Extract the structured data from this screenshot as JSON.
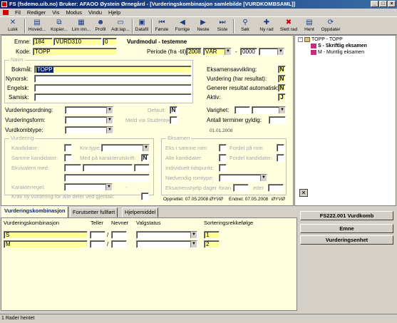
{
  "window": {
    "title": "FS (fsdemo.uib.no) Bruker: AFAOO Øystein Ørnegård - [Vurderingskombinasjon samlebilde   [VURDKOMBSAML]]"
  },
  "menu": [
    "Fil",
    "Rediger",
    "Vis",
    "Modus",
    "Vindu",
    "Hjelp"
  ],
  "toolbar": [
    {
      "label": "Lukk",
      "icon": "close-icon"
    },
    {
      "label": "Hoved...",
      "icon": "home-icon"
    },
    {
      "label": "Kopier...",
      "icon": "copy-icon"
    },
    {
      "label": "Lim inn...",
      "icon": "paste-icon"
    },
    {
      "label": "Profil",
      "icon": "profile-icon"
    },
    {
      "label": "Adr.lap...",
      "icon": "address-label-icon"
    },
    {
      "label": "Datafil",
      "icon": "datafile-icon"
    },
    {
      "label": "Første",
      "icon": "first-icon"
    },
    {
      "label": "Forrige",
      "icon": "previous-icon"
    },
    {
      "label": "Neste",
      "icon": "next-icon"
    },
    {
      "label": "Siste",
      "icon": "last-icon"
    },
    {
      "label": "Søk",
      "icon": "search-icon"
    },
    {
      "label": "Ny rad",
      "icon": "new-row-icon"
    },
    {
      "label": "Slett rad",
      "icon": "delete-row-icon"
    },
    {
      "label": "Hent",
      "icon": "fetch-icon"
    },
    {
      "label": "Oppdater",
      "icon": "update-icon"
    }
  ],
  "header": {
    "emne_label": "Emne:",
    "emne_code": "184",
    "emne_id": "VURD310",
    "emne_version": "0",
    "module_title": "Vurdmodul - testemne",
    "kode_label": "Kode:",
    "kode_value": "TOPP",
    "periode_label": "Periode (fra -til):",
    "periode_year": "2008",
    "periode_term": "VÅR",
    "periode_dash": "-",
    "periode_to": "0000"
  },
  "navn": {
    "group_label": "Navn",
    "bokmal_label": "Bokmål:",
    "bokmal_value": "TOPP",
    "nynorsk_label": "Nynorsk:",
    "engelsk_label": "Engelsk:",
    "samisk_label": "Samisk:"
  },
  "flags": {
    "eksamensavvikling_label": "Eksamensavvikling:",
    "eksamensavvikling": "N",
    "vurdering_har_resultat_label": "Vurdering (har resultat):",
    "vurdering_har_resultat": "N",
    "generer_resultat_label": "Generer resultat automatisk:",
    "generer_resultat": "N",
    "aktiv_label": "Aktiv:",
    "aktiv": "J"
  },
  "vurd": {
    "ordning_label": "Vurderingsordning:",
    "form_label": "Vurderingsform:",
    "kombtype_label": "Vurdkombtype:",
    "default_label": "Default:",
    "default_value": "N",
    "meld_label": "Meld via Studentweb:",
    "varighet_label": "Varighet:",
    "antall_terminer_label": "Antall terminer gyldig:",
    "date_value": "01.01.2008"
  },
  "vurdering_group": {
    "group_label": "Vurdering",
    "kandidator": "Kandidator:",
    "knr_type": "Knr.type:",
    "samme_kandidatnr": "Samme kandidatnr:",
    "med_pa_karakterutskrift": "Med på karakterutskrift:",
    "med_pa_value": "N",
    "ekvivalent_med": "Ekvivalent med:",
    "karakterregel": "Karakterregel:",
    "karakterregel_dash": "-",
    "krav_ny_vurdering": "Krav ny vurdering for alle deler ved gjentak:"
  },
  "eksamen_group": {
    "group_label": "Eksamen",
    "eks_i_samme_rom": "Eks i samme rom:",
    "fordel_pa_rom": "Fordel på rom:",
    "alle_kandidater": "Alle kandidater:",
    "fordel_kandidater": "Fordel kandidater:",
    "individuelt_tidspunkt": "Individuelt tidspunkt:",
    "nodvendig_romtype": "Nødvendig romtype:",
    "eksamenshjelp_dager": "Eksamenshjelp dager",
    "foran": "foran",
    "etter": "etter"
  },
  "audit": {
    "opprettet": "Opprettet: 07.05.2008",
    "opprettet_user": "ØYVØ",
    "endret": "Endret: 07.05.2008",
    "endret_user": "ØYVØ"
  },
  "tree": {
    "root": "TOPP - TOPP",
    "children": [
      "S - Skriftlig eksamen",
      "M - Muntlig eksamen"
    ]
  },
  "tabs": [
    "Vurderingskombinasjon",
    "Forutsetter fullført",
    "Hjelpemiddel"
  ],
  "grid": {
    "headers": [
      "Vurderingskombinasjon",
      "Teller",
      "Nevner",
      "Valgstatus",
      "Sorteringsrekkefølge"
    ],
    "rows": [
      {
        "komb": "S",
        "slash": "/",
        "sort": "1"
      },
      {
        "komb": "M",
        "slash": "/",
        "sort": "2"
      }
    ]
  },
  "actions": [
    "FS222.001 Vurdkomb",
    "Emne",
    "Vurderingsenhet"
  ],
  "status": "1 Rader hentet",
  "close_glyph": "✕",
  "colors": {
    "title_start": "#0a246a",
    "title_end": "#3a6ea5",
    "form_bg": "#ffffe0",
    "required_bg": "#ffff9c",
    "chrome": "#d4d0c8"
  }
}
